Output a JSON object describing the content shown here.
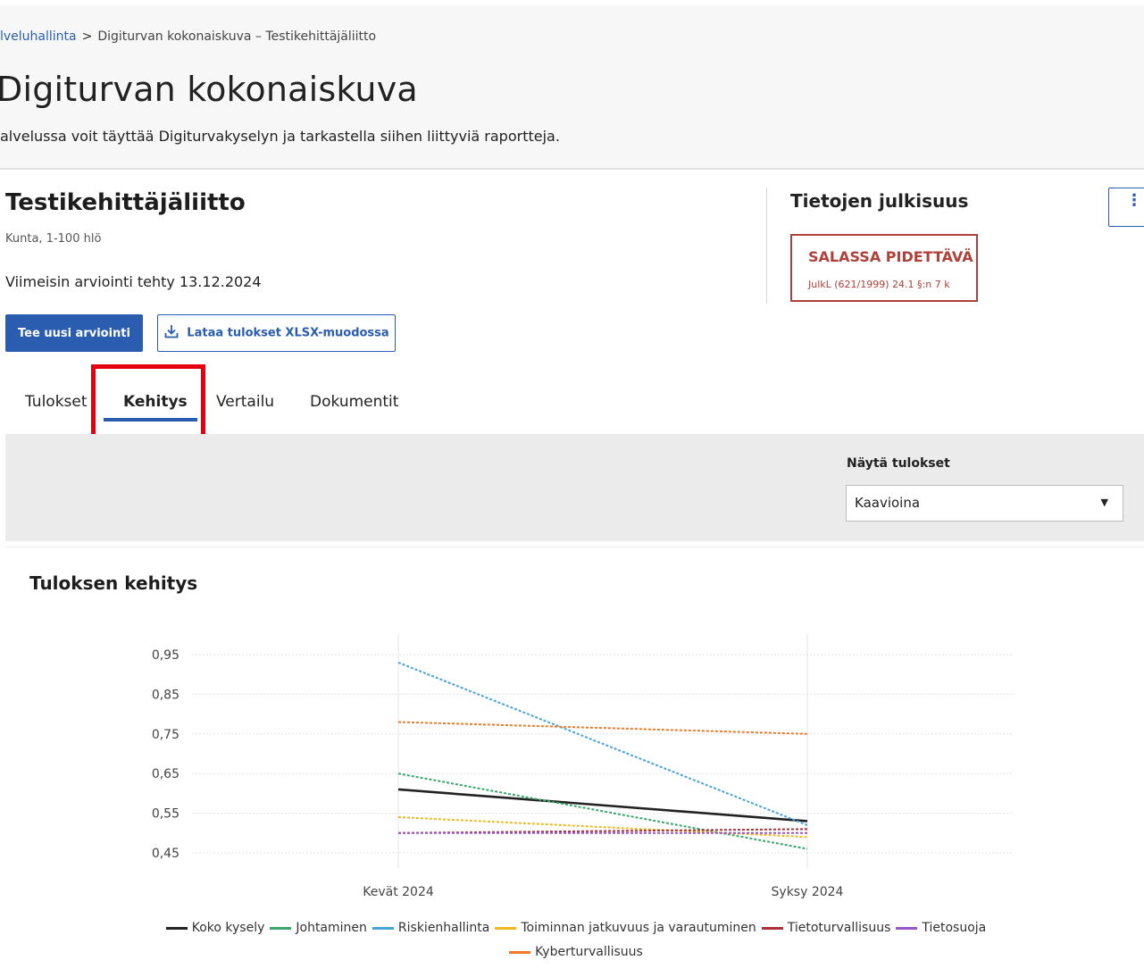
{
  "header": {
    "breadcrumb": {
      "parent": "lveluhallinta",
      "separator": ">",
      "current": "Digiturvan kokonaiskuva – Testikehittäjäliitto"
    },
    "title": "Digiturvan kokonaiskuva",
    "lead": "alvelussa voit täyttää Digiturvakyselyn ja tarkastella siihen liittyviä raportteja."
  },
  "org": {
    "name": "Testikehittäjäliitto",
    "subtitle": "Kunta, 1-100 hlö",
    "last_assessment": "Viimeisin arviointi tehty 13.12.2024"
  },
  "publicity": {
    "title": "Tietojen julkisuus",
    "label": "SALASSA PIDETTÄVÄ",
    "law": "JulkL (621/1999) 24.1 §:n 7 k"
  },
  "actions": {
    "new_assessment": "Tee uusi arviointi",
    "download_xlsx": "Lataa tulokset XLSX-muodossa"
  },
  "tabs": [
    {
      "label": "Tulokset",
      "active": false
    },
    {
      "label": "Kehitys",
      "active": true
    },
    {
      "label": "Vertailu",
      "active": false
    },
    {
      "label": "Dokumentit",
      "active": false
    }
  ],
  "filter": {
    "label": "Näytä tulokset",
    "value": "Kaavioina"
  },
  "chart_section": {
    "title": "Tuloksen kehitys"
  },
  "chart_data": {
    "type": "line",
    "title": "Tuloksen kehitys",
    "x": [
      "Kevät 2024",
      "Syksy 2024"
    ],
    "ytick_labels": [
      "0,95",
      "0,85",
      "0,75",
      "0,65",
      "0,55",
      "0,45"
    ],
    "yticks": [
      0.95,
      0.85,
      0.75,
      0.65,
      0.55,
      0.45
    ],
    "ylim": [
      0.45,
      0.95
    ],
    "grid": true,
    "legend_position": "bottom",
    "series": [
      {
        "name": "Koko kysely",
        "values": [
          0.61,
          0.53
        ],
        "color": "#222222",
        "dashed": false
      },
      {
        "name": "Johtaminen",
        "values": [
          0.65,
          0.46
        ],
        "color": "#3aa66b",
        "dashed": true
      },
      {
        "name": "Riskienhallinta",
        "values": [
          0.93,
          0.52
        ],
        "color": "#4aa3d8",
        "dashed": true
      },
      {
        "name": "Toiminnan jatkuvuus ja varautuminen",
        "values": [
          0.54,
          0.49
        ],
        "color": "#f2b824",
        "dashed": true
      },
      {
        "name": "Tietoturvallisuus",
        "values": [
          0.5,
          0.51
        ],
        "color": "#b0303a",
        "dashed": true
      },
      {
        "name": "Tietosuoja",
        "values": [
          0.5,
          0.5
        ],
        "color": "#9a56c8",
        "dashed": true
      },
      {
        "name": "Kyberturvallisuus",
        "values": [
          0.78,
          0.75
        ],
        "color": "#f07a2a",
        "dashed": true
      }
    ]
  }
}
